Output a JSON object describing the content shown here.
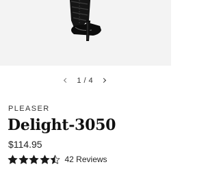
{
  "gallery": {
    "current_page": "1",
    "separator": "/",
    "total_pages": "4"
  },
  "product": {
    "brand": "PLEASER",
    "name": "Delight-3050",
    "price": "$114.95",
    "rating": 4.5,
    "reviews_label": "42 Reviews"
  },
  "colors": {
    "star": "#1a1a1a",
    "gallery_background": "#f3f3f3"
  }
}
